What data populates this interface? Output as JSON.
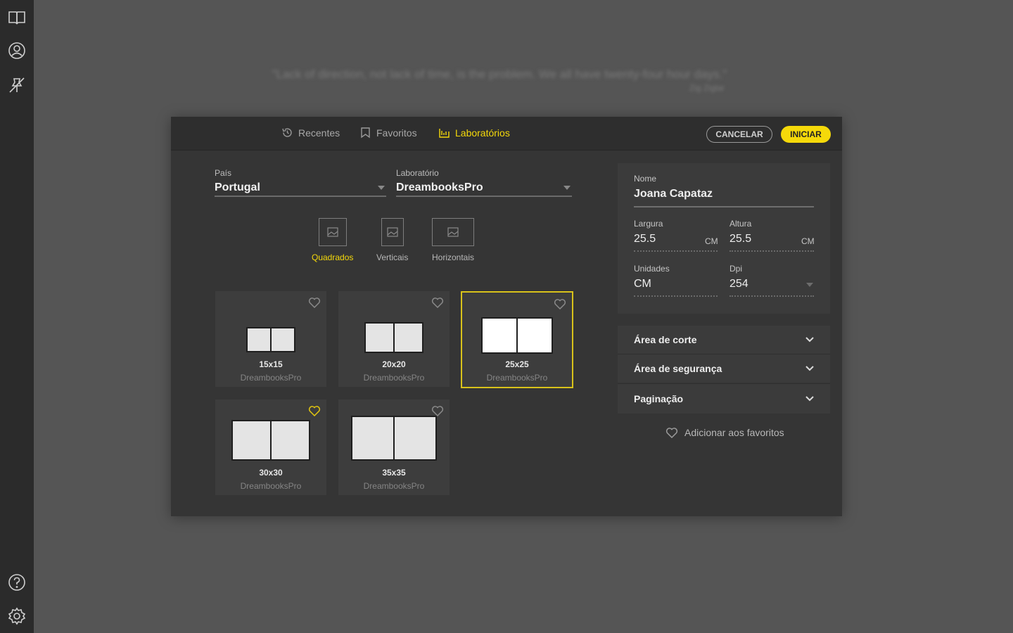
{
  "background": {
    "quote": "\"Lack of direction, not lack of time, is the problem. We all have twenty-four hour days.\"",
    "author": "Zig Ziglar"
  },
  "rail": {
    "icons": [
      "book-icon",
      "user-icon",
      "pin-off-icon",
      "help-icon",
      "settings-icon"
    ]
  },
  "tabs": [
    {
      "label": "Recentes",
      "icon": "history-icon"
    },
    {
      "label": "Favoritos",
      "icon": "bookmark-icon"
    },
    {
      "label": "Laboratórios",
      "icon": "lab-icon",
      "active": true
    }
  ],
  "buttons": {
    "cancel": "CANCELAR",
    "start": "INICIAR"
  },
  "country": {
    "label": "País",
    "value": "Portugal"
  },
  "laboratory": {
    "label": "Laboratório",
    "value": "DreambooksPro"
  },
  "orientations": [
    {
      "label": "Quadrados",
      "active": true
    },
    {
      "label": "Verticais",
      "active": false
    },
    {
      "label": "Horizontais",
      "active": false
    }
  ],
  "formats": [
    {
      "size": "15x15",
      "lab": "DreambooksPro",
      "favorite": false,
      "selected": false
    },
    {
      "size": "20x20",
      "lab": "DreambooksPro",
      "favorite": false,
      "selected": false
    },
    {
      "size": "25x25",
      "lab": "DreambooksPro",
      "favorite": false,
      "selected": true
    },
    {
      "size": "30x30",
      "lab": "DreambooksPro",
      "favorite": true,
      "selected": false
    },
    {
      "size": "35x35",
      "lab": "DreambooksPro",
      "favorite": false,
      "selected": false
    }
  ],
  "details": {
    "name_label": "Nome",
    "name_value": "Joana Capataz",
    "width_label": "Largura",
    "width_value": "25.5",
    "width_unit": "CM",
    "height_label": "Altura",
    "height_value": "25.5",
    "height_unit": "CM",
    "units_label": "Unidades",
    "units_value": "CM",
    "dpi_label": "Dpi",
    "dpi_value": "254"
  },
  "accordions": [
    {
      "label": "Área de corte"
    },
    {
      "label": "Área de segurança"
    },
    {
      "label": "Paginação"
    }
  ],
  "add_favorites": "Adicionar aos favoritos",
  "colors": {
    "accent": "#f5d90a",
    "modal_bg": "#353535",
    "rail_bg": "#2b2b2b"
  }
}
